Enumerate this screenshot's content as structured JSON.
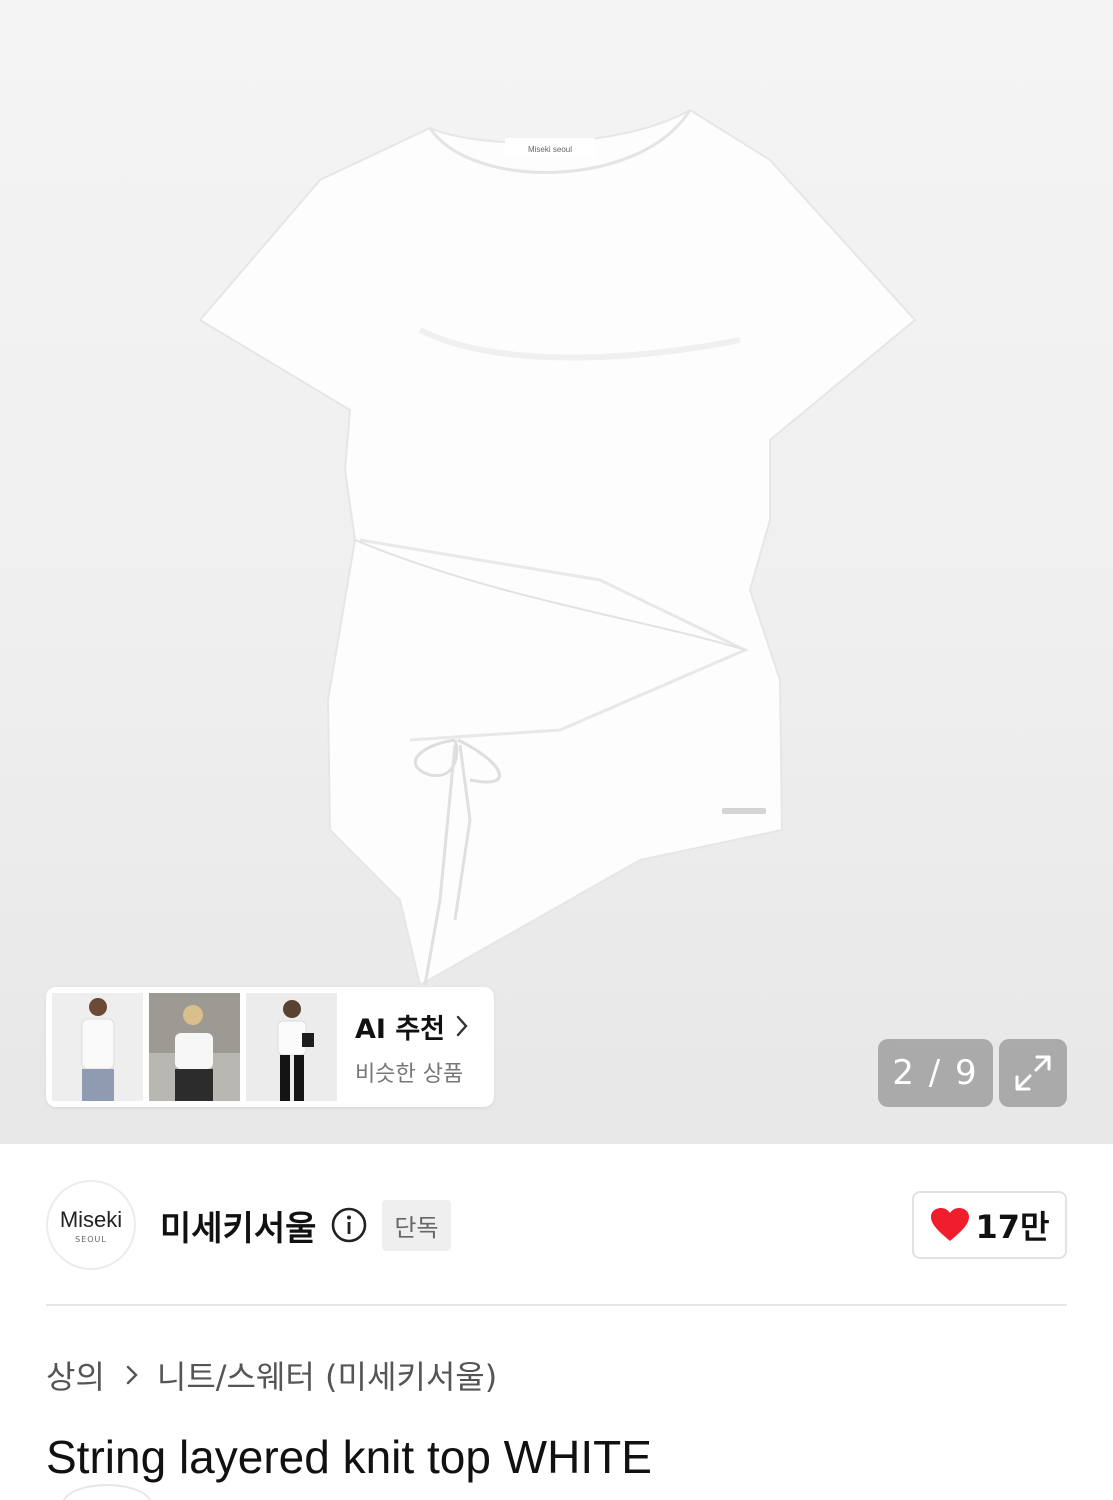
{
  "gallery": {
    "counter": "2 / 9",
    "shirt_label": "Miseki seoul"
  },
  "ai_recommend": {
    "title": "AI 추천",
    "subtitle": "비슷한 상품"
  },
  "brand": {
    "logo_main": "Miseki",
    "logo_sub": "SEOUL",
    "name": "미세키서울",
    "badge": "단독",
    "likes": "17만"
  },
  "breadcrumb": {
    "category": "상의",
    "subcategory": "니트/스웨터 (미세키서울)"
  },
  "product": {
    "title": "String layered knit top WHITE"
  },
  "colors": {
    "heart": "#f01e2c",
    "counter_bg": "#969696"
  }
}
